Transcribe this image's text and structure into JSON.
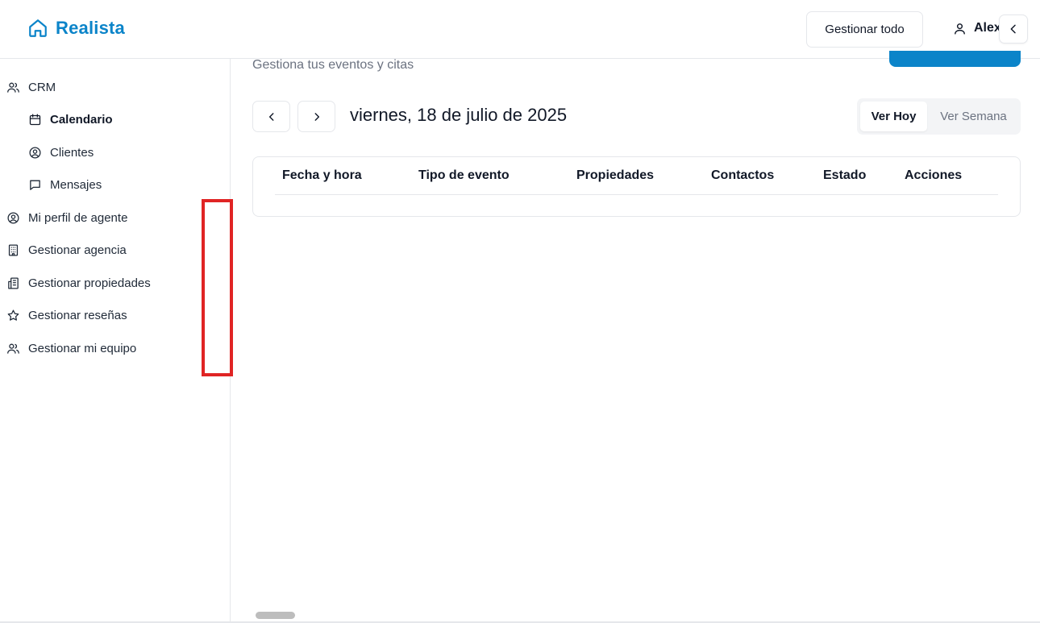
{
  "header": {
    "brand": "Realista",
    "manage_all_label": "Gestionar todo",
    "user_name": "Alex"
  },
  "sidebar": {
    "items": [
      {
        "label": "CRM",
        "icon": "users-icon"
      },
      {
        "label": "Calendario",
        "icon": "calendar-icon",
        "active": true
      },
      {
        "label": "Clientes",
        "icon": "user-circle-icon"
      },
      {
        "label": "Mensajes",
        "icon": "message-icon"
      },
      {
        "label": "Mi perfil de agente",
        "icon": "user-circle-icon"
      },
      {
        "label": "Gestionar agencia",
        "icon": "building-icon"
      },
      {
        "label": "Gestionar propiedades",
        "icon": "buildings-icon"
      },
      {
        "label": "Gestionar reseñas",
        "icon": "star-icon"
      },
      {
        "label": "Gestionar mi equipo",
        "icon": "users-icon"
      }
    ]
  },
  "main": {
    "subtitle": "Gestiona tus eventos y citas",
    "date_title": "viernes, 18 de julio de 2025",
    "view_toggle": {
      "today": "Ver Hoy",
      "week": "Ver Semana",
      "selected": "Ver Hoy"
    },
    "table": {
      "columns": [
        "Fecha y hora",
        "Tipo de evento",
        "Propiedades",
        "Contactos",
        "Estado",
        "Acciones"
      ],
      "rows": []
    }
  },
  "colors": {
    "brand": "#0b84c9",
    "annotation": "#e02424"
  }
}
